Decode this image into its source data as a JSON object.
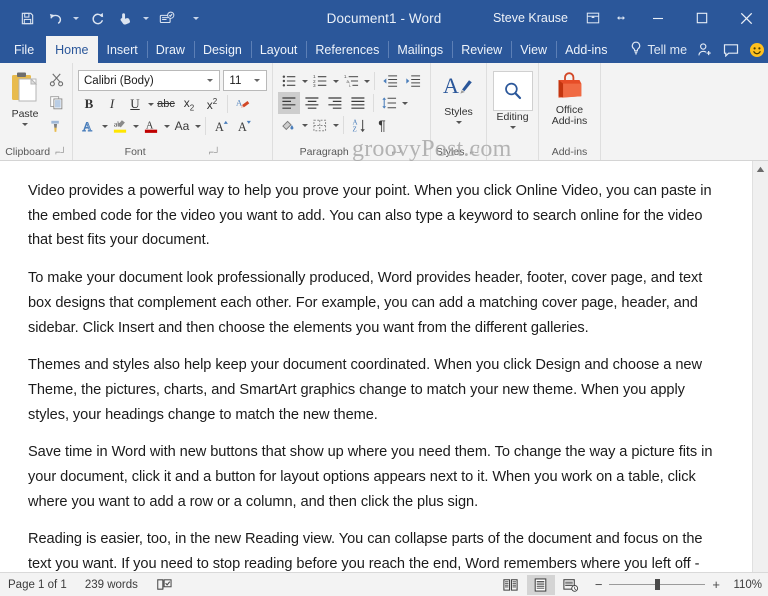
{
  "window": {
    "title": "Document1  -  Word",
    "user": "Steve Krause",
    "accent": "#2b579a",
    "quick_access": [
      {
        "name": "save-icon",
        "label": "Save"
      },
      {
        "name": "undo-icon",
        "label": "Undo"
      },
      {
        "name": "redo-icon",
        "label": "Redo"
      },
      {
        "name": "touch-mouse-mode-icon",
        "label": "Touch/Mouse Mode"
      },
      {
        "name": "spelling-grammar-icon",
        "label": "Spelling & Grammar"
      },
      {
        "name": "customize-quick-access-toolbar-icon",
        "label": "Customize Quick Access Toolbar"
      }
    ],
    "controls": [
      {
        "name": "ribbon-display-options-icon",
        "label": "Ribbon Display Options"
      },
      {
        "name": "collapse-ribbon-icon",
        "label": "Collapse the Ribbon"
      },
      {
        "name": "minimize-button",
        "label": "Minimize"
      },
      {
        "name": "maximize-button",
        "label": "Maximize"
      },
      {
        "name": "close-button",
        "label": "Close"
      }
    ]
  },
  "tabs": [
    {
      "label": "File",
      "active": false
    },
    {
      "label": "Home",
      "active": true
    },
    {
      "label": "Insert",
      "active": false
    },
    {
      "label": "Draw",
      "active": false
    },
    {
      "label": "Design",
      "active": false
    },
    {
      "label": "Layout",
      "active": false
    },
    {
      "label": "References",
      "active": false
    },
    {
      "label": "Mailings",
      "active": false
    },
    {
      "label": "Review",
      "active": false
    },
    {
      "label": "View",
      "active": false
    },
    {
      "label": "Add-ins",
      "active": false
    }
  ],
  "tellme": {
    "label": "Tell me",
    "icon": "lightbulb-icon"
  },
  "tabstrip_right": [
    {
      "name": "share-icon",
      "label": "Share"
    },
    {
      "name": "comments-icon",
      "label": "Comments"
    },
    {
      "name": "feedback-smiley-icon",
      "label": "Send a Smile"
    }
  ],
  "ribbon": {
    "groups": [
      {
        "label": "Clipboard",
        "dialog_launcher": true,
        "big_button": {
          "label": "Paste",
          "icon": "paste-clipboard-icon",
          "has_dropdown": true
        },
        "small_buttons": [
          {
            "name": "cut-scissors-icon",
            "label": "Cut"
          },
          {
            "name": "copy-icon",
            "label": "Copy"
          },
          {
            "name": "format-painter-icon",
            "label": "Format Painter"
          }
        ]
      },
      {
        "label": "Font",
        "dialog_launcher": true,
        "font_name": {
          "value": "Calibri (Body)",
          "placeholder": "Font"
        },
        "font_size": {
          "value": "11",
          "placeholder": "Size"
        },
        "row_bold": [
          {
            "name": "bold-button",
            "label": "B"
          },
          {
            "name": "italic-button",
            "label": "I"
          },
          {
            "name": "underline-button",
            "label": "U"
          },
          {
            "name": "strikethrough-button",
            "label": "abc"
          },
          {
            "name": "subscript-button",
            "label": "X2"
          },
          {
            "name": "superscript-button",
            "label": "X2"
          },
          {
            "name": "clear-formatting-icon",
            "label": "Clear All Formatting"
          }
        ],
        "row_effects": [
          {
            "name": "text-effects-icon",
            "label": "Text Effects and Typography"
          },
          {
            "name": "text-highlight-color-icon",
            "label": "Text Highlight Color"
          },
          {
            "name": "font-color-icon",
            "label": "Font Color"
          },
          {
            "name": "change-case-icon",
            "label": "Aa"
          },
          {
            "name": "grow-font-icon",
            "label": "A"
          },
          {
            "name": "shrink-font-icon",
            "label": "A"
          }
        ]
      },
      {
        "label": "Paragraph",
        "dialog_launcher": true,
        "row_lists": [
          {
            "name": "bullets-icon",
            "label": "Bullets"
          },
          {
            "name": "numbering-icon",
            "label": "Numbering"
          },
          {
            "name": "multilevel-list-icon",
            "label": "Multilevel List"
          },
          {
            "name": "decrease-indent-icon",
            "label": "Decrease Indent"
          },
          {
            "name": "increase-indent-icon",
            "label": "Increase Indent"
          }
        ],
        "row_align": [
          {
            "name": "align-left-button",
            "label": "Align Left",
            "active": true
          },
          {
            "name": "align-center-button",
            "label": "Center",
            "active": false
          },
          {
            "name": "align-right-button",
            "label": "Align Right",
            "active": false
          },
          {
            "name": "justify-button",
            "label": "Justify",
            "active": false
          },
          {
            "name": "line-spacing-icon",
            "label": "Line and Paragraph Spacing"
          }
        ],
        "row_misc": [
          {
            "name": "shading-icon",
            "label": "Shading"
          },
          {
            "name": "borders-icon",
            "label": "Borders"
          },
          {
            "name": "sort-icon",
            "label": "Sort"
          },
          {
            "name": "show-formatting-marks-icon",
            "label": "¶"
          }
        ]
      },
      {
        "label": "Styles",
        "dialog_launcher": true,
        "big_button": {
          "label": "Styles",
          "icon": "styles-icon",
          "has_dropdown": true
        }
      },
      {
        "label": "",
        "dialog_launcher": false,
        "big_button": {
          "label": "Editing",
          "icon": "editing-magnifier-icon",
          "has_dropdown": true
        }
      },
      {
        "label": "Add-ins",
        "dialog_launcher": false,
        "big_button": {
          "label": "Office\nAdd-ins",
          "icon": "office-addins-bag-icon",
          "has_dropdown": false
        }
      }
    ]
  },
  "watermark": "groovyPost.com",
  "document": {
    "paragraphs": [
      "Video provides a powerful way to help you prove your point. When you click Online Video, you can paste in the embed code for the video you want to add. You can also type a keyword to search online for the video that best fits your document.",
      "To make your document look professionally produced, Word provides header, footer, cover page, and text box designs that complement each other. For example, you can add a matching cover page, header, and sidebar. Click Insert and then choose the elements you want from the different galleries.",
      "Themes and styles also help keep your document coordinated. When you click Design and choose a new Theme, the pictures, charts, and SmartArt graphics change to match your new theme. When you apply styles, your headings change to match the new theme.",
      "Save time in Word with new buttons that show up where you need them. To change the way a picture fits in your document, click it and a button for layout options appears next to it. When you work on a table, click where you want to add a row or a column, and then click the plus sign.",
      "Reading is easier, too, in the new Reading view. You can collapse parts of the document and focus on the text you want. If you need to stop reading before you reach the end, Word remembers where you left off - even on another device."
    ]
  },
  "statusbar": {
    "page": "Page 1 of 1",
    "words": "239 words",
    "proofing_icon": "proofing-errors-icon",
    "views": [
      {
        "name": "read-mode-button",
        "label": "Read Mode",
        "active": false
      },
      {
        "name": "print-layout-button",
        "label": "Print Layout",
        "active": true
      },
      {
        "name": "web-layout-button",
        "label": "Web Layout",
        "active": false
      }
    ],
    "zoom_out": "−",
    "zoom_in": "+",
    "zoom_value": "110%"
  }
}
